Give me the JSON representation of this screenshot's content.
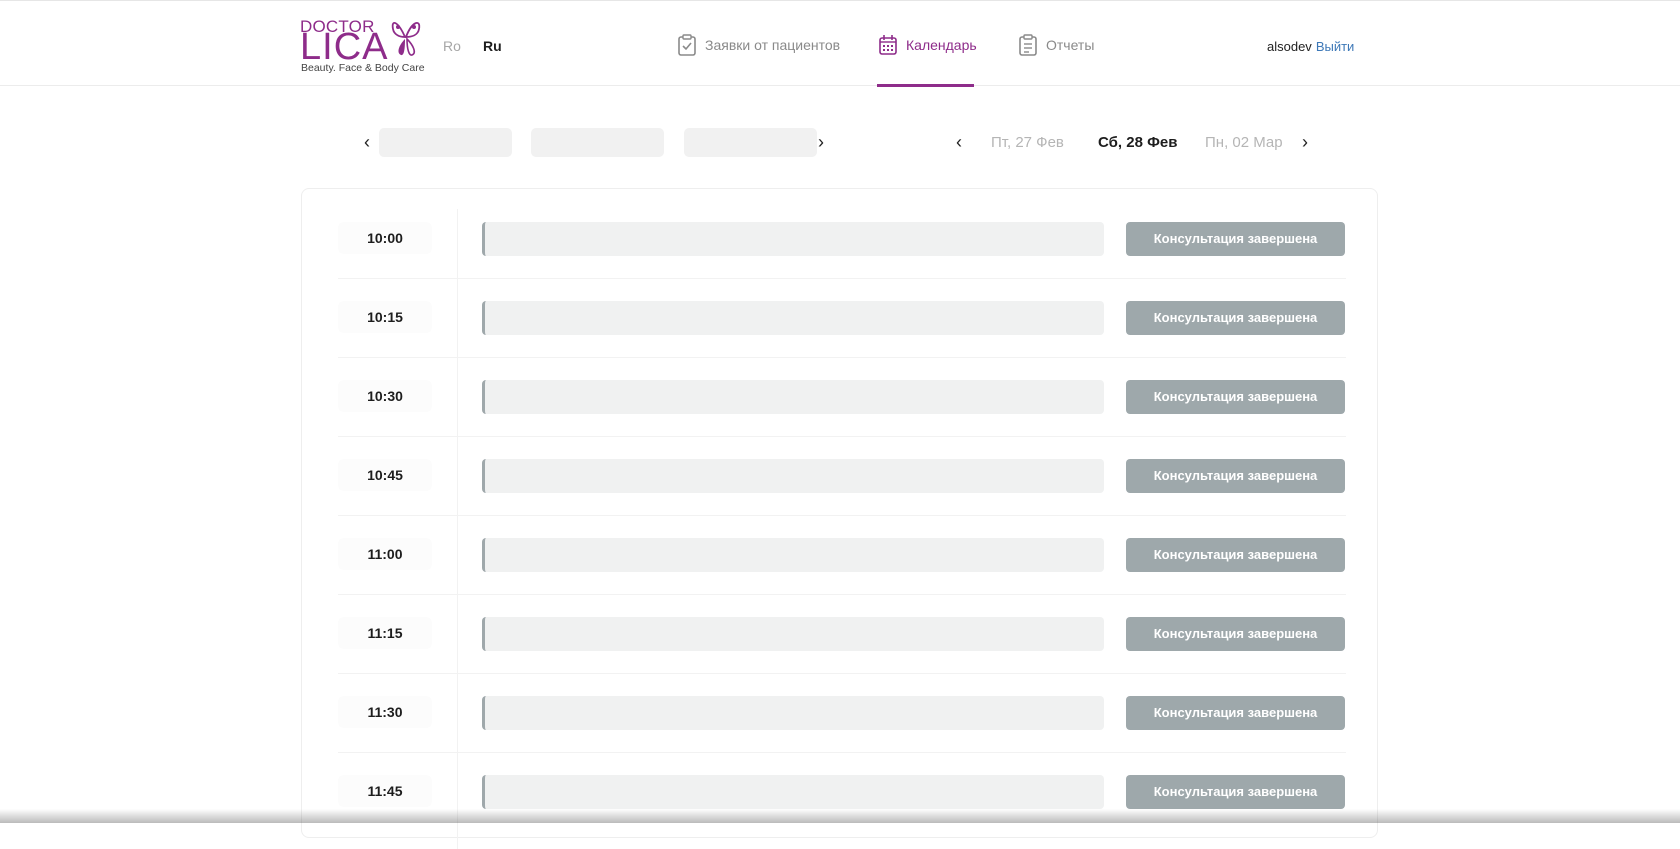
{
  "brand": {
    "top": "DOCTOR",
    "name": "LICA",
    "tagline": "Beauty. Face & Body Care",
    "color": "#8e2c8a"
  },
  "languages": {
    "ro": "Ro",
    "ru": "Ru",
    "active": "Ru"
  },
  "nav": {
    "requests": {
      "label": "Заявки от пациентов",
      "icon": "clipboard-check-icon"
    },
    "calendar": {
      "label": "Календарь",
      "icon": "calendar-icon",
      "active": true
    },
    "reports": {
      "label": "Отчеты",
      "icon": "report-list-icon"
    }
  },
  "user": {
    "name": "alsodev",
    "logout": "Выйти"
  },
  "day_nav": {
    "prev": "Пт, 27 Фев",
    "current": "Сб, 28 Фев",
    "next": "Пн, 02 Мар"
  },
  "slots": [
    {
      "time": "10:00",
      "status": "Консультация завершена"
    },
    {
      "time": "10:15",
      "status": "Консультация завершена"
    },
    {
      "time": "10:30",
      "status": "Консультация завершена"
    },
    {
      "time": "10:45",
      "status": "Консультация завершена"
    },
    {
      "time": "11:00",
      "status": "Консультация завершена"
    },
    {
      "time": "11:15",
      "status": "Консультация завершена"
    },
    {
      "time": "11:30",
      "status": "Консультация завершена"
    },
    {
      "time": "11:45",
      "status": "Консультация завершена"
    }
  ],
  "colors": {
    "accent": "#8e2c8a",
    "status_button": "#9ea8ab",
    "link": "#3d78b7"
  }
}
